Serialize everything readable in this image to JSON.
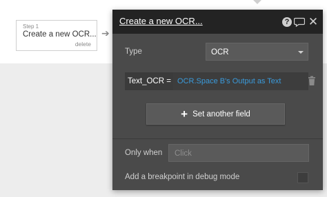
{
  "step": {
    "number_label": "Step 1",
    "title": "Create a new OCR...",
    "delete_label": "delete"
  },
  "panel": {
    "title": "Create a new OCR...",
    "type_label": "Type",
    "type_value": "OCR",
    "field": {
      "key": "Text_OCR",
      "operator": "=",
      "value": "OCR.Space B's Output as Text"
    },
    "set_another_field_label": "Set another field",
    "only_when_label": "Only when",
    "only_when_placeholder": "Click",
    "breakpoint_label": "Add a breakpoint in debug mode"
  },
  "colors": {
    "panel_bg": "#4a4a4a",
    "header_bg": "#232323",
    "link_blue": "#3a9bdc"
  },
  "icons": [
    "help-icon",
    "comment-icon",
    "close-icon",
    "trash-icon",
    "plus-icon",
    "chevron-down-icon",
    "arrow-right-icon"
  ]
}
